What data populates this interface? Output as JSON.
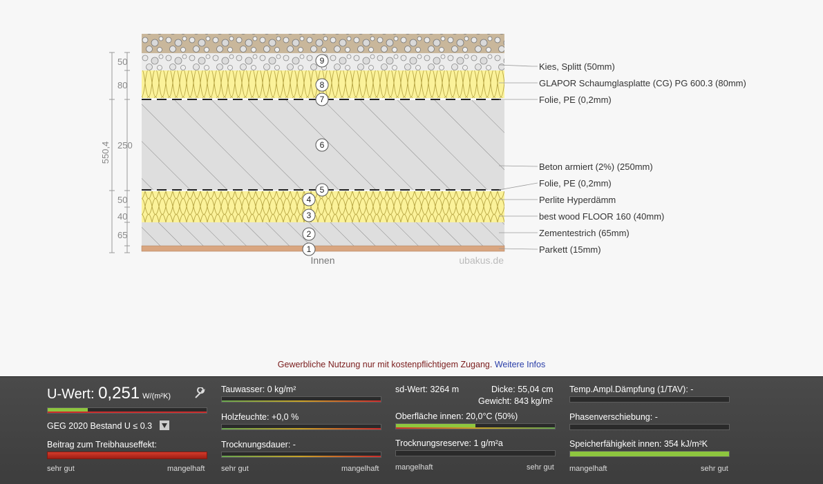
{
  "diagram": {
    "total_thickness": "550,4",
    "thickness_labels": [
      "50",
      "80",
      "250",
      "50",
      "40",
      "65"
    ],
    "inside_label": "Innen",
    "watermark": "ubakus.de",
    "layers": [
      {
        "number": "9",
        "label": "Kies, Splitt (50mm)"
      },
      {
        "number": "8",
        "label": "GLAPOR Schaumglasplatte (CG) PG 600.3 (80mm)"
      },
      {
        "number": "7",
        "label": "Folie, PE (0,2mm)"
      },
      {
        "number": "6",
        "label": "Beton armiert (2%) (250mm)"
      },
      {
        "number": "5",
        "label": "Folie, PE (0,2mm)"
      },
      {
        "number": "4",
        "label": "Perlite Hyperdämm"
      },
      {
        "number": "3",
        "label": "best wood FLOOR 160 (40mm)"
      },
      {
        "number": "2",
        "label": "Zementestrich (65mm)"
      },
      {
        "number": "1",
        "label": "Parkett (15mm)"
      }
    ]
  },
  "notice": {
    "text": "Gewerbliche Nutzung nur mit kostenpflichtigem Zugang. ",
    "link": "Weitere Infos"
  },
  "panel": {
    "u_label": "U-Wert: ",
    "u_value": "0,251",
    "u_unit": "W/(m²K)",
    "geg": "GEG 2020 Bestand U ≤ 0.3",
    "treibhaus": "Beitrag zum Treibhauseffekt:",
    "tauwasser": "Tauwasser: 0 kg/m²",
    "holzfeuchte": "Holzfeuchte: +0,0 %",
    "trocknungsdauer": "Trocknungsdauer: -",
    "sd": "sd-Wert: 3264 m",
    "dicke": "Dicke: 55,04 cm",
    "gewicht": "Gewicht: 843 kg/m²",
    "oberflaeche": "Oberfläche innen: 20,0°C (50%)",
    "trocknungsreserve": "Trocknungsreserve: 1 g/m²a",
    "tav": "Temp.Ampl.Dämpfung (1/TAV): -",
    "phasen": "Phasenverschiebung: -",
    "speicher": "Speicherfähigkeit innen: 354 kJ/m²K",
    "scale_good": "sehr gut",
    "scale_bad": "mangelhaft",
    "u_fill": 0.25,
    "oberflaeche_fill": 0.5,
    "speicher_fill": 1.0
  }
}
